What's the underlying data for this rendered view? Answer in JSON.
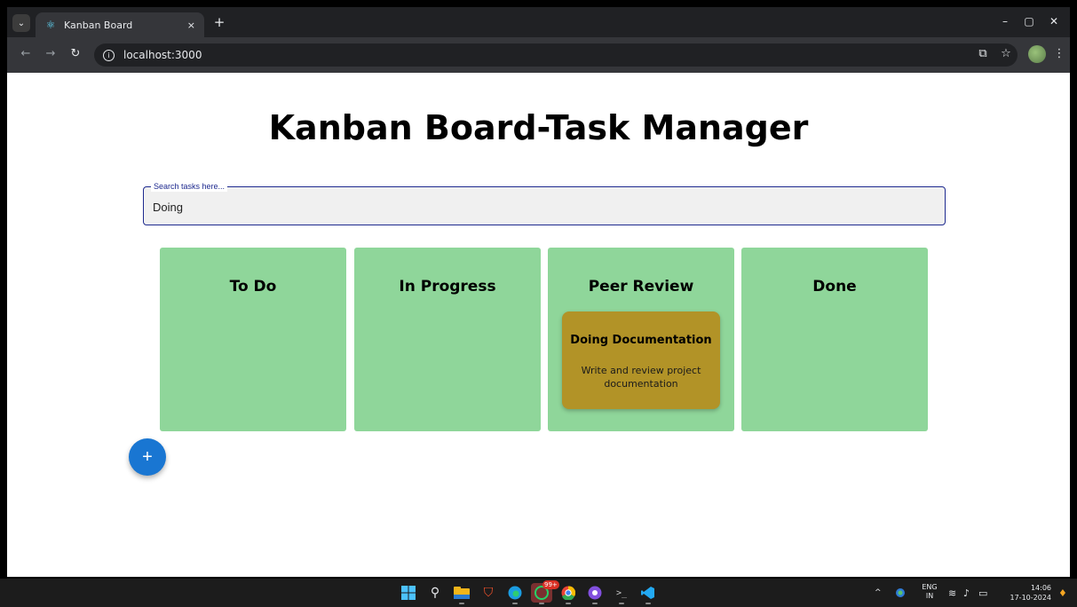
{
  "browser": {
    "tab_title": "Kanban Board",
    "tab_favicon": "react-icon",
    "tab_close": "×",
    "new_tab": "+",
    "url": "localhost:3000",
    "window_controls": [
      "–",
      "▢",
      "✕"
    ]
  },
  "page": {
    "title": "Kanban Board-Task Manager",
    "search": {
      "label": "Search tasks here...",
      "value": "Doing"
    },
    "columns": [
      {
        "title": "To Do",
        "tasks": []
      },
      {
        "title": "In Progress",
        "tasks": []
      },
      {
        "title": "Peer Review",
        "tasks": [
          {
            "title": "Doing Documentation",
            "description": "Write and review project documentation"
          }
        ]
      },
      {
        "title": "Done",
        "tasks": []
      }
    ],
    "add_button_label": "+"
  },
  "taskbar": {
    "whatsapp_badge": "99+",
    "language": [
      "ENG",
      "IN"
    ],
    "time": "14:06",
    "date": "17-10-2024"
  },
  "colors": {
    "column_bg": "#8fd69a",
    "card_bg": "#b29327",
    "fab_bg": "#1976d2",
    "search_border": "#1e2a8f"
  }
}
